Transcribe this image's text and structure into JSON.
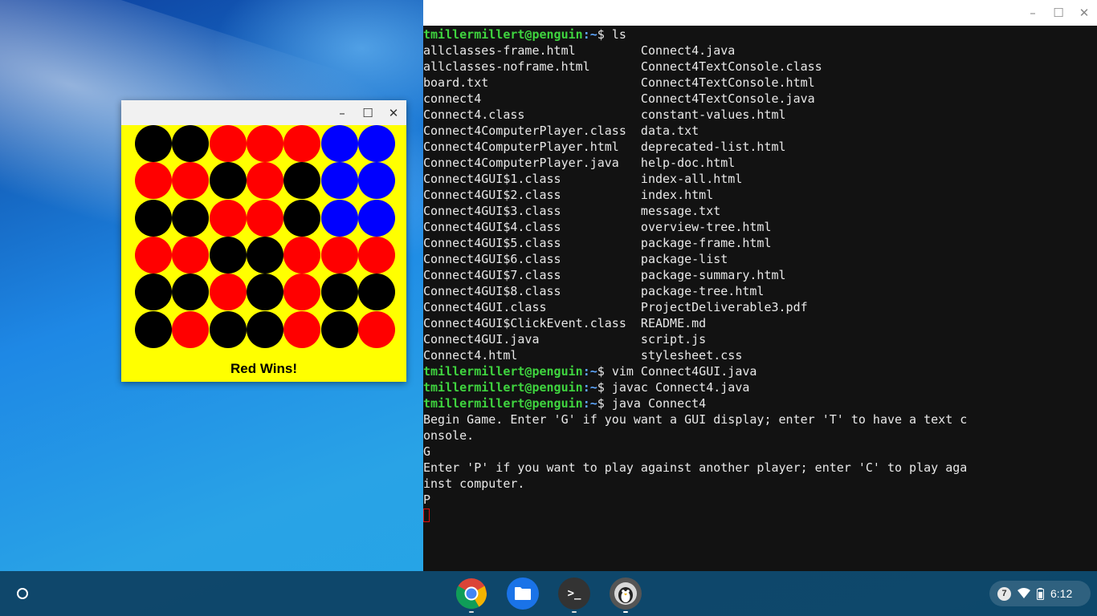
{
  "gui": {
    "status": "Red Wins!",
    "board": [
      [
        "black",
        "black",
        "red",
        "red",
        "red",
        "blue",
        "blue"
      ],
      [
        "red",
        "red",
        "black",
        "red",
        "black",
        "blue",
        "blue"
      ],
      [
        "black",
        "black",
        "red",
        "red",
        "black",
        "blue",
        "blue"
      ],
      [
        "red",
        "red",
        "black",
        "black",
        "red",
        "red",
        "red"
      ],
      [
        "black",
        "black",
        "red",
        "black",
        "red",
        "black",
        "black"
      ],
      [
        "black",
        "red",
        "black",
        "black",
        "red",
        "black",
        "red"
      ]
    ],
    "colors": {
      "red": "#ff0000",
      "black": "#000000",
      "blue": "#0000ff",
      "background": "#ffff00"
    },
    "controls": {
      "minimize": "–",
      "maximize": "☐",
      "close": "✕"
    }
  },
  "terminal": {
    "controls": {
      "minimize": "–",
      "maximize": "☐",
      "close": "✕"
    },
    "prompt_user": "tmillermillert@penguin",
    "prompt_path": ":~",
    "prompt_suffix": "$ ",
    "lines": [
      {
        "type": "prompt",
        "cmd": "ls"
      },
      {
        "type": "out",
        "text": "allclasses-frame.html         Connect4.java"
      },
      {
        "type": "out",
        "text": "allclasses-noframe.html       Connect4TextConsole.class"
      },
      {
        "type": "out",
        "text": "board.txt                     Connect4TextConsole.html"
      },
      {
        "type": "out",
        "text": "connect4                      Connect4TextConsole.java"
      },
      {
        "type": "out",
        "text": "Connect4.class                constant-values.html"
      },
      {
        "type": "out",
        "text": "Connect4ComputerPlayer.class  data.txt"
      },
      {
        "type": "out",
        "text": "Connect4ComputerPlayer.html   deprecated-list.html"
      },
      {
        "type": "out",
        "text": "Connect4ComputerPlayer.java   help-doc.html"
      },
      {
        "type": "out",
        "text": "Connect4GUI$1.class           index-all.html"
      },
      {
        "type": "out",
        "text": "Connect4GUI$2.class           index.html"
      },
      {
        "type": "out",
        "text": "Connect4GUI$3.class           message.txt"
      },
      {
        "type": "out",
        "text": "Connect4GUI$4.class           overview-tree.html"
      },
      {
        "type": "out",
        "text": "Connect4GUI$5.class           package-frame.html"
      },
      {
        "type": "out",
        "text": "Connect4GUI$6.class           package-list"
      },
      {
        "type": "out",
        "text": "Connect4GUI$7.class           package-summary.html"
      },
      {
        "type": "out",
        "text": "Connect4GUI$8.class           package-tree.html"
      },
      {
        "type": "out",
        "text": "Connect4GUI.class             ProjectDeliverable3.pdf"
      },
      {
        "type": "out",
        "text": "Connect4GUI$ClickEvent.class  README.md"
      },
      {
        "type": "out",
        "text": "Connect4GUI.java              script.js"
      },
      {
        "type": "out",
        "text": "Connect4.html                 stylesheet.css"
      },
      {
        "type": "prompt",
        "cmd": "vim Connect4GUI.java"
      },
      {
        "type": "prompt",
        "cmd": "javac Connect4.java"
      },
      {
        "type": "prompt",
        "cmd": "java Connect4"
      },
      {
        "type": "out",
        "text": "Begin Game. Enter 'G' if you want a GUI display; enter 'T' to have a text c"
      },
      {
        "type": "out",
        "text": "onsole."
      },
      {
        "type": "out",
        "text": "G"
      },
      {
        "type": "out",
        "text": "Enter 'P' if you want to play against another player; enter 'C' to play aga"
      },
      {
        "type": "out",
        "text": "inst computer."
      },
      {
        "type": "out",
        "text": "P"
      },
      {
        "type": "cursor"
      }
    ]
  },
  "shelf": {
    "apps": [
      {
        "name": "chrome-icon"
      },
      {
        "name": "files-icon"
      },
      {
        "name": "terminal-icon",
        "glyph": ">_"
      },
      {
        "name": "linux-penguin-icon"
      }
    ],
    "tray": {
      "notifications": "7",
      "time": "6:12"
    }
  }
}
